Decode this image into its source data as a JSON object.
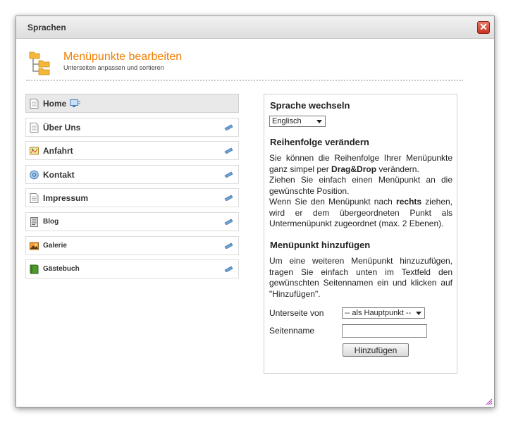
{
  "dialog": {
    "title": "Sprachen",
    "close_label": "✕"
  },
  "header": {
    "title": "Menüpunkte bearbeiten",
    "subtitle": "Unterseiten anpassen und sortieren"
  },
  "menu": {
    "items": [
      {
        "label": "Home",
        "icon": "page-icon"
      },
      {
        "label": "Über Uns",
        "icon": "page-icon"
      },
      {
        "label": "Anfahrt",
        "icon": "map-icon"
      },
      {
        "label": "Kontakt",
        "icon": "contact-icon"
      },
      {
        "label": "Impressum",
        "icon": "page-icon"
      },
      {
        "label": "Blog",
        "icon": "blog-icon"
      },
      {
        "label": "Galerie",
        "icon": "gallery-icon"
      },
      {
        "label": "Gästebuch",
        "icon": "guestbook-icon"
      }
    ]
  },
  "language": {
    "heading": "Sprache wechseln",
    "selected": "Englisch"
  },
  "order": {
    "heading": "Reihenfolge verändern",
    "text_1": "Sie können die Reihenfolge Ihrer Menüpunkte ganz simpel per ",
    "text_bold_1": "Drag&Drop",
    "text_2": " verändern.",
    "text_3": "Ziehen Sie einfach einen Menüpunkt an die gewünschte Position.",
    "text_4": "Wenn Sie den Menüpunkt nach ",
    "text_bold_2": "rechts",
    "text_5": " ziehen, wird er dem übergeordneten Punkt als Untermenüpunkt zugeordnet (max. 2 Ebenen)."
  },
  "add": {
    "heading": "Menüpunkt hinzufügen",
    "text": "Um eine weiteren Menüpunkt hinzuzufügen, tragen Sie einfach unten im Textfeld den gewünschten Seitennamen ein und klicken auf \"Hinzufügen\".",
    "parent_label": "Unterseite von",
    "parent_selected": "-- als Hauptpunkt --",
    "name_label": "Seitenname",
    "name_value": "",
    "button_label": "Hinzufügen"
  },
  "colors": {
    "accent": "#f07d00",
    "close": "#c8321f"
  }
}
